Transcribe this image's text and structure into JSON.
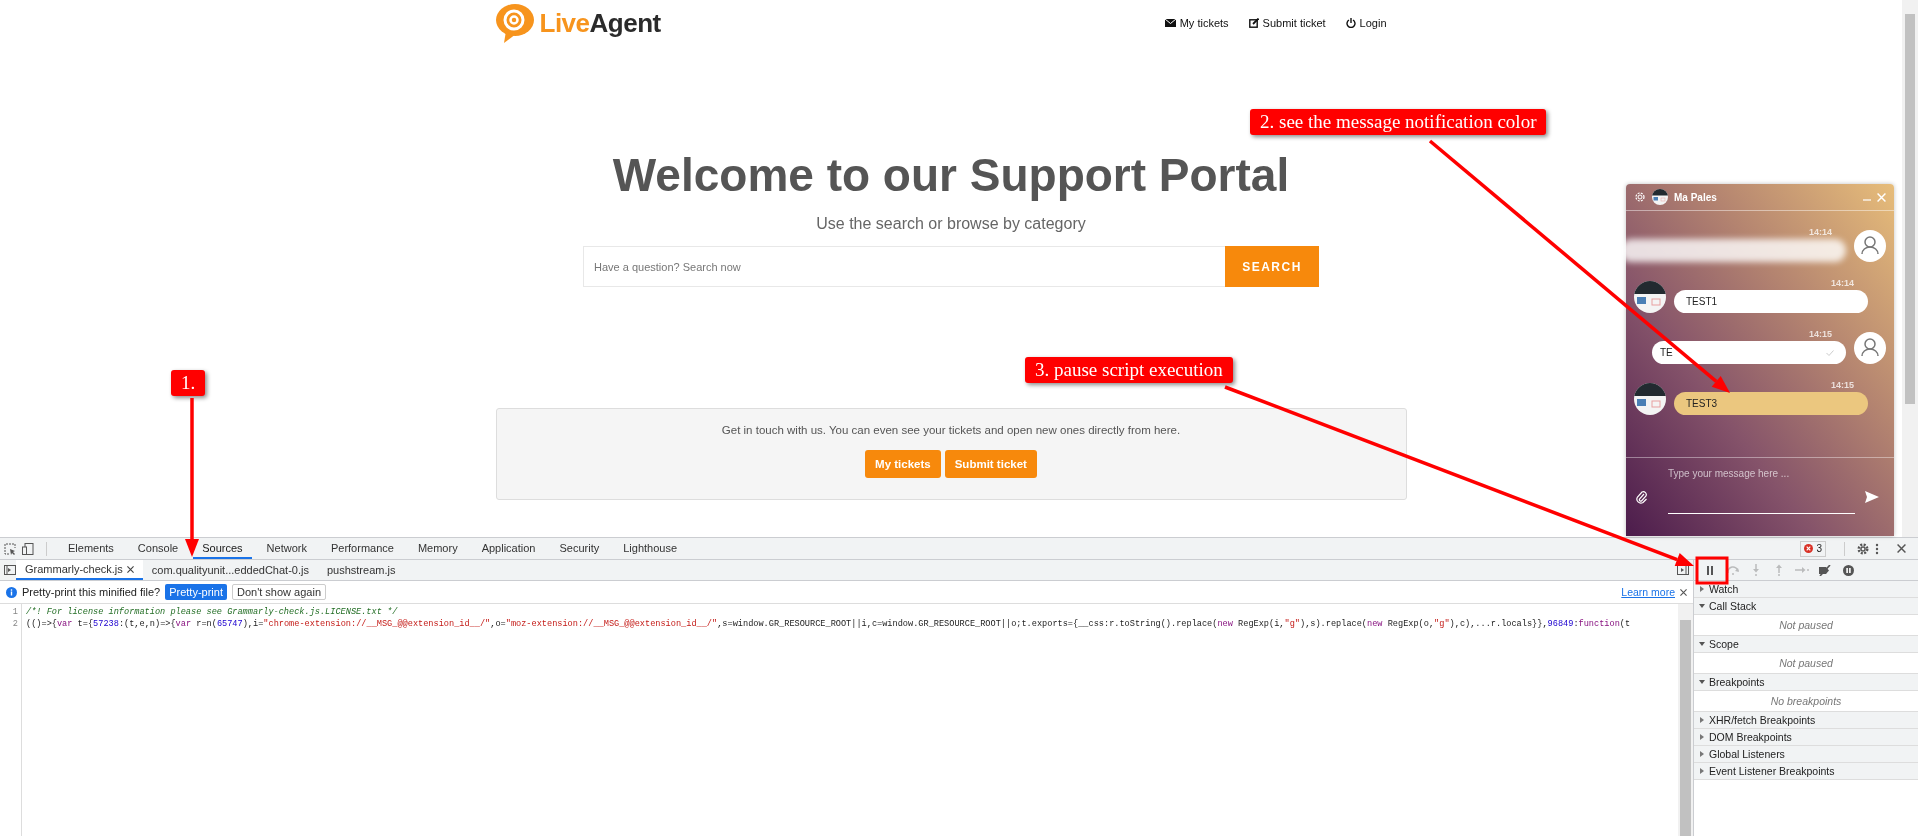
{
  "site": {
    "brand_part_1": "Live",
    "brand_part_2": "Agent",
    "nav": [
      {
        "kind": "mail",
        "label": "My tickets"
      },
      {
        "kind": "edit",
        "label": "Submit ticket"
      },
      {
        "kind": "power",
        "label": "Login"
      }
    ],
    "title": "Welcome to our Support Portal",
    "subtitle": "Use the search or browse by category",
    "search": {
      "placeholder": "Have a question? Search now",
      "button": "SEARCH"
    },
    "contact": {
      "text": "Get in touch with us. You can even see your tickets and open new ones directly from here.",
      "buttons": [
        "My tickets",
        "Submit ticket"
      ]
    }
  },
  "chat": {
    "agent_name": "Ma Pales",
    "placeholder": "Type your message here ...",
    "messages": [
      {
        "kind": "visitor",
        "time": "14:14",
        "blurred": true
      },
      {
        "kind": "agent",
        "time": "14:14",
        "blurred": false,
        "highlighted": false,
        "text": "TEST1"
      },
      {
        "kind": "visitor",
        "time": "14:15",
        "blurred": false,
        "text": "TE"
      },
      {
        "kind": "agent",
        "time": "14:15",
        "blurred": false,
        "highlighted": true,
        "text": "TEST3"
      }
    ]
  },
  "devtools": {
    "tabs": [
      {
        "label": "Elements",
        "selected": false
      },
      {
        "label": "Console",
        "selected": false
      },
      {
        "label": "Sources",
        "selected": true
      },
      {
        "label": "Network",
        "selected": false
      },
      {
        "label": "Performance",
        "selected": false
      },
      {
        "label": "Memory",
        "selected": false
      },
      {
        "label": "Application",
        "selected": false
      },
      {
        "label": "Security",
        "selected": false
      },
      {
        "label": "Lighthouse",
        "selected": false
      }
    ],
    "error_count": "3",
    "file_tabs": [
      {
        "label": "Grammarly-check.js",
        "selected": true
      },
      {
        "label": "com.qualityunit...eddedChat-0.js",
        "selected": false
      },
      {
        "label": "pushstream.js",
        "selected": false
      }
    ],
    "infobar": {
      "text": "Pretty-print this minified file?",
      "primary_button": "Pretty-print",
      "secondary_button": "Don't show again",
      "link": "Learn more"
    },
    "code_lines": [
      {
        "number": "1",
        "segments": [
          {
            "kind": "comment",
            "text": "/*! For license information please see Grammarly-check.js.LICENSE.txt */"
          }
        ]
      },
      {
        "number": "2",
        "segments": [
          {
            "kind": "plain",
            "text": "(()=>{"
          },
          {
            "kind": "keyword",
            "text": "var"
          },
          {
            "kind": "plain",
            "text": " t={"
          },
          {
            "kind": "number",
            "text": "57238"
          },
          {
            "kind": "plain",
            "text": ":(t,e,n)=>{"
          },
          {
            "kind": "keyword",
            "text": "var"
          },
          {
            "kind": "plain",
            "text": " r=n("
          },
          {
            "kind": "number",
            "text": "65747"
          },
          {
            "kind": "plain",
            "text": "),i="
          },
          {
            "kind": "string",
            "text": "\"chrome-extension://__MSG_@@extension_id__/\""
          },
          {
            "kind": "plain",
            "text": ",o="
          },
          {
            "kind": "string",
            "text": "\"moz-extension://__MSG_@@extension_id__/\""
          },
          {
            "kind": "plain",
            "text": ",s=window.GR_RESOURCE_ROOT||i,c=window.GR_RESOURCE_ROOT||o;t.exports={__css:r.toString().replace("
          },
          {
            "kind": "keyword",
            "text": "new"
          },
          {
            "kind": "plain",
            "text": " RegExp(i,"
          },
          {
            "kind": "string",
            "text": "\"g\""
          },
          {
            "kind": "plain",
            "text": "),s).replace("
          },
          {
            "kind": "keyword",
            "text": "new"
          },
          {
            "kind": "plain",
            "text": " RegExp(o,"
          },
          {
            "kind": "string",
            "text": "\"g\""
          },
          {
            "kind": "plain",
            "text": "),c),...r.locals}},"
          },
          {
            "kind": "number",
            "text": "96849"
          },
          {
            "kind": "plain",
            "text": ":"
          },
          {
            "kind": "keyword",
            "text": "function"
          },
          {
            "kind": "plain",
            "text": "(t"
          }
        ]
      }
    ],
    "debug_buttons": [
      {
        "kind": "pause",
        "disabled": false
      },
      {
        "kind": "step-over",
        "disabled": true
      },
      {
        "kind": "step-into",
        "disabled": true
      },
      {
        "kind": "step-out",
        "disabled": true
      },
      {
        "kind": "step",
        "disabled": true
      },
      {
        "kind": "deactivate",
        "disabled": false
      },
      {
        "kind": "pause-exceptions",
        "disabled": false
      }
    ],
    "sections": [
      {
        "title": "Watch",
        "expanded": false
      },
      {
        "title": "Call Stack",
        "expanded": true,
        "content": "Not paused"
      },
      {
        "title": "Scope",
        "expanded": true,
        "content": "Not paused"
      },
      {
        "title": "Breakpoints",
        "expanded": true,
        "content": "No breakpoints"
      },
      {
        "title": "XHR/fetch Breakpoints",
        "expanded": false
      },
      {
        "title": "DOM Breakpoints",
        "expanded": false
      },
      {
        "title": "Global Listeners",
        "expanded": false
      },
      {
        "title": "Event Listener Breakpoints",
        "expanded": false
      }
    ]
  },
  "annotations": [
    {
      "label": "1."
    },
    {
      "label": "2. see the message notification color"
    },
    {
      "label": "3. pause script execution"
    }
  ]
}
